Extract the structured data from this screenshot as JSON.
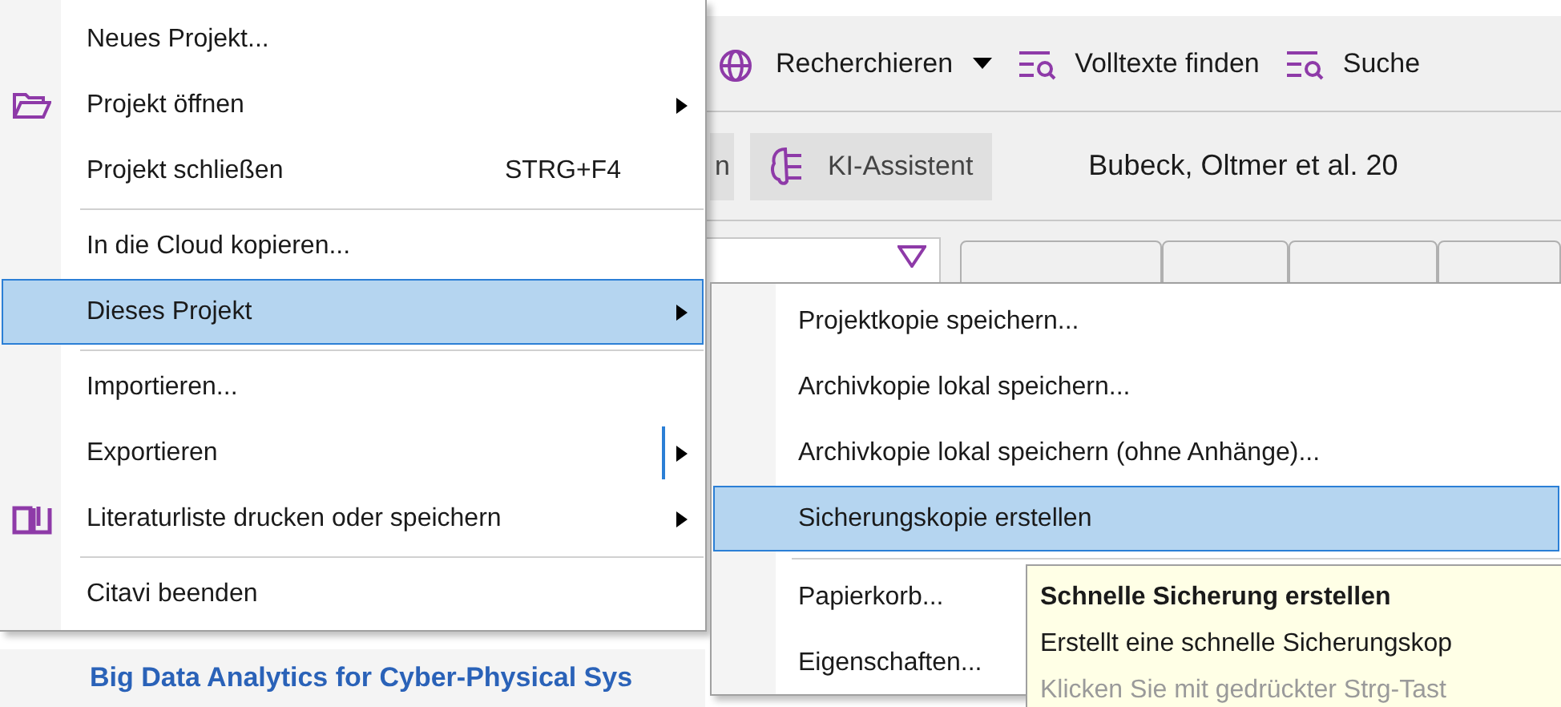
{
  "toolbar": [
    {
      "label": "Recherchieren",
      "dropdown": true
    },
    {
      "label": "Volltexte finden",
      "dropdown": false
    },
    {
      "label": "Suche",
      "dropdown": false
    }
  ],
  "secondary_bar": {
    "partial_button": "n",
    "assistant_button": "KI-Assistent",
    "reference_title": "Bubeck, Oltmer et al. 20"
  },
  "list": {
    "title": "Big Data Analytics for Cyber-Physical Sys"
  },
  "menu": [
    {
      "kind": "item",
      "label": "Neues Projekt...",
      "submenu": false,
      "selected": false
    },
    {
      "kind": "item",
      "label": "Projekt öffnen",
      "submenu": true,
      "selected": false
    },
    {
      "kind": "item",
      "label": "Projekt schließen",
      "shortcut": "STRG+F4",
      "submenu": false,
      "selected": false
    },
    {
      "kind": "separator"
    },
    {
      "kind": "item",
      "label": "In die Cloud kopieren...",
      "submenu": false,
      "selected": false
    },
    {
      "kind": "item",
      "label": "Dieses Projekt",
      "submenu": true,
      "selected": true
    },
    {
      "kind": "separator"
    },
    {
      "kind": "item",
      "label": "Importieren...",
      "submenu": false,
      "selected": false
    },
    {
      "kind": "item",
      "label": "Exportieren",
      "submenu": true,
      "selected": false
    },
    {
      "kind": "item",
      "label": "Literaturliste drucken oder speichern",
      "submenu": true,
      "selected": false
    },
    {
      "kind": "separator"
    },
    {
      "kind": "item",
      "label": "Citavi beenden",
      "submenu": false,
      "selected": false
    }
  ],
  "submenu": [
    {
      "kind": "item",
      "label": "Projektkopie speichern...",
      "selected": false
    },
    {
      "kind": "item",
      "label": "Archivkopie lokal speichern...",
      "selected": false
    },
    {
      "kind": "item",
      "label": "Archivkopie lokal speichern (ohne Anhänge)...",
      "selected": false
    },
    {
      "kind": "item",
      "label": "Sicherungskopie erstellen",
      "selected": true
    },
    {
      "kind": "separator"
    },
    {
      "kind": "item",
      "label": "Papierkorb...",
      "selected": false
    },
    {
      "kind": "item",
      "label": "Eigenschaften...",
      "selected": false
    }
  ],
  "tooltip": {
    "title": "Schnelle Sicherung erstellen",
    "text": "Erstellt eine schnelle Sicherungskop",
    "hint": "Klicken Sie mit gedrückter Strg-Tast"
  }
}
